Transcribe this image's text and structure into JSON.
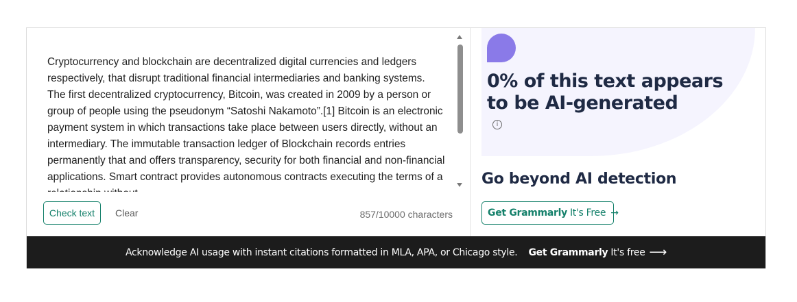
{
  "editor": {
    "text": "Cryptocurrency and blockchain are decentralized digital currencies and ledgers respectively, that disrupt traditional financial intermediaries and banking systems. The first decentralized cryptocurrency, Bitcoin, was created in 2009 by a person or group of people using the pseudonym “Satoshi Nakamoto”.[1] Bitcoin is an electronic payment system in which transactions take place between users directly, without an intermediary. The immutable transaction ledger of Blockchain records entries permanently that and offers transparency, security for both financial and non-financial applications. Smart contract provides autonomous contracts executing the terms of a relationship without",
    "check_label": "Check text",
    "clear_label": "Clear",
    "char_count": "857/10000 characters"
  },
  "result": {
    "title": "0% of this text appears to be AI-generated",
    "info_glyph": "i"
  },
  "upsell": {
    "title": "Go beyond AI detection",
    "button_brand": "Get Grammarly",
    "button_suffix": "It's Free",
    "button_arrow": "→"
  },
  "banner": {
    "message": "Acknowledge AI usage with instant citations formatted in MLA, APA, or Chicago style.",
    "cta_brand": "Get Grammarly",
    "cta_suffix": "It's free",
    "cta_arrow": "⟶"
  },
  "colors": {
    "accent": "#14806a",
    "purple": "#8a7ae8",
    "banner_bg": "#1c1c1c",
    "panel_bg": "#f5f4fe"
  }
}
